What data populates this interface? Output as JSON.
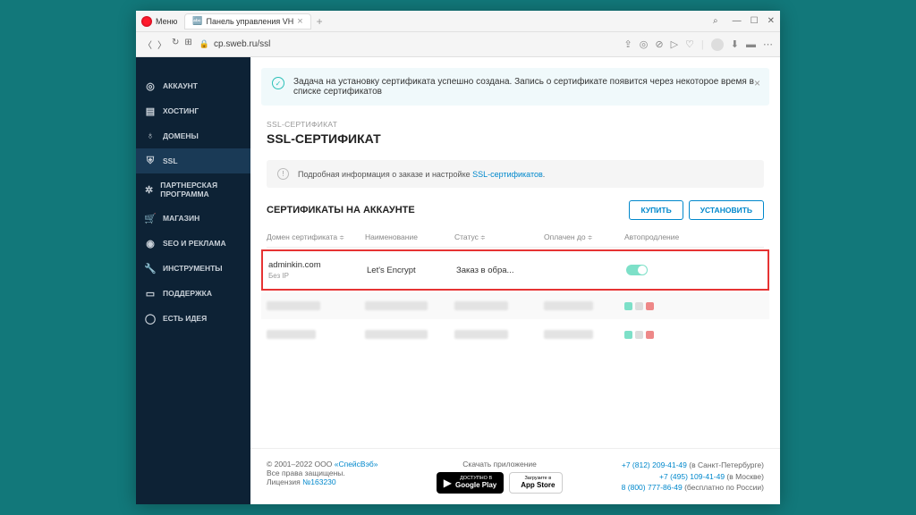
{
  "browser": {
    "menu": "Меню",
    "tab_title": "Панель управления VH",
    "url": "cp.sweb.ru/ssl"
  },
  "sidebar": {
    "items": [
      {
        "icon": "◎",
        "label": "АККАУНТ"
      },
      {
        "icon": "▤",
        "label": "ХОСТИНГ"
      },
      {
        "icon": "♁",
        "label": "ДОМЕНЫ"
      },
      {
        "icon": "⛨",
        "label": "SSL",
        "active": true
      },
      {
        "icon": "✲",
        "label": "ПАРТНЕРСКАЯ ПРОГРАММА"
      },
      {
        "icon": "🛒",
        "label": "МАГАЗИН"
      },
      {
        "icon": "◉",
        "label": "SEO И РЕКЛАМА"
      },
      {
        "icon": "🔧",
        "label": "ИНСТРУМЕНТЫ"
      },
      {
        "icon": "▭",
        "label": "ПОДДЕРЖКА"
      },
      {
        "icon": "◯",
        "label": "ЕСТЬ ИДЕЯ"
      }
    ]
  },
  "alert": {
    "text": "Задача на установку сертификата успешно создана. Запись о сертификате появится через некоторое время в списке сертификатов"
  },
  "page": {
    "breadcrumb": "SSL-СЕРТИФИКАТ",
    "title": "SSL-СЕРТИФИКАТ",
    "info_prefix": "Подробная информация о заказе и настройке ",
    "info_link": "SSL-сертификатов",
    "table_title": "СЕРТИФИКАТЫ НА АККАУНТЕ",
    "buy": "КУПИТЬ",
    "install": "УСТАНОВИТЬ"
  },
  "table": {
    "headers": {
      "domain": "Домен сертификата",
      "name": "Наименование",
      "status": "Статус",
      "paid": "Оплачен до",
      "auto": "Автопродление"
    },
    "row": {
      "domain": "adminkin.com",
      "no_ip": "Без IP",
      "name": "Let's Encrypt",
      "status": "Заказ в обра..."
    }
  },
  "footer": {
    "copyright": "© 2001–2022 ООО ",
    "company": "«СпейсВэб»",
    "rights": "Все права защищены.",
    "license_label": "Лицензия ",
    "license": "№163230",
    "download": "Скачать приложение",
    "gp_small": "ДОСТУПНО В",
    "gp": "Google Play",
    "as_small": "Загрузите в",
    "as": "App Store",
    "phone1": "+7 (812) 209-41-49",
    "phone1_loc": " (в Санкт-Петербурге)",
    "phone2": "+7 (495) 109-41-49",
    "phone2_loc": " (в Москве)",
    "phone3": "8 (800) 777-86-49",
    "phone3_loc": " (бесплатно по России)"
  }
}
